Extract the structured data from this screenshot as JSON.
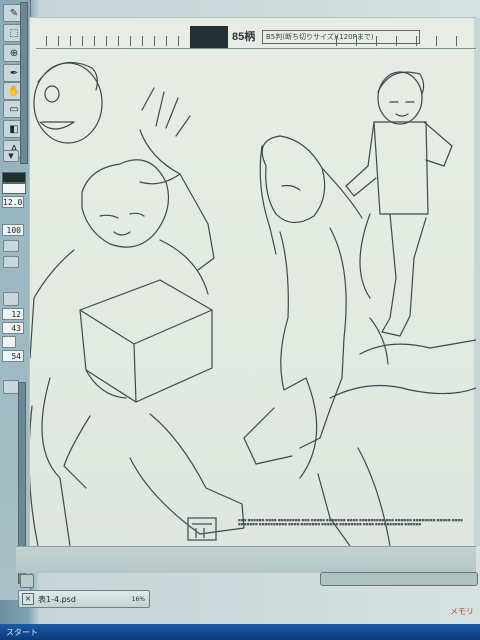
{
  "document": {
    "filename": "表1-4.psd",
    "zoom": "16%"
  },
  "page_header": {
    "page_number": "85柄",
    "note": "B5判(断ち切りサイズ)(120Pまで)"
  },
  "tool_panel": {
    "fields": [
      "12.0",
      "100",
      "12",
      "43",
      "54"
    ]
  },
  "status": {
    "memory": "メモリ",
    "taskbar_text": "スタート"
  },
  "colors": {
    "background": "#2f3a3c",
    "canvas": "#e5ebe3",
    "line": "#3d4a4d",
    "taskbar": "#1b5aa8"
  }
}
